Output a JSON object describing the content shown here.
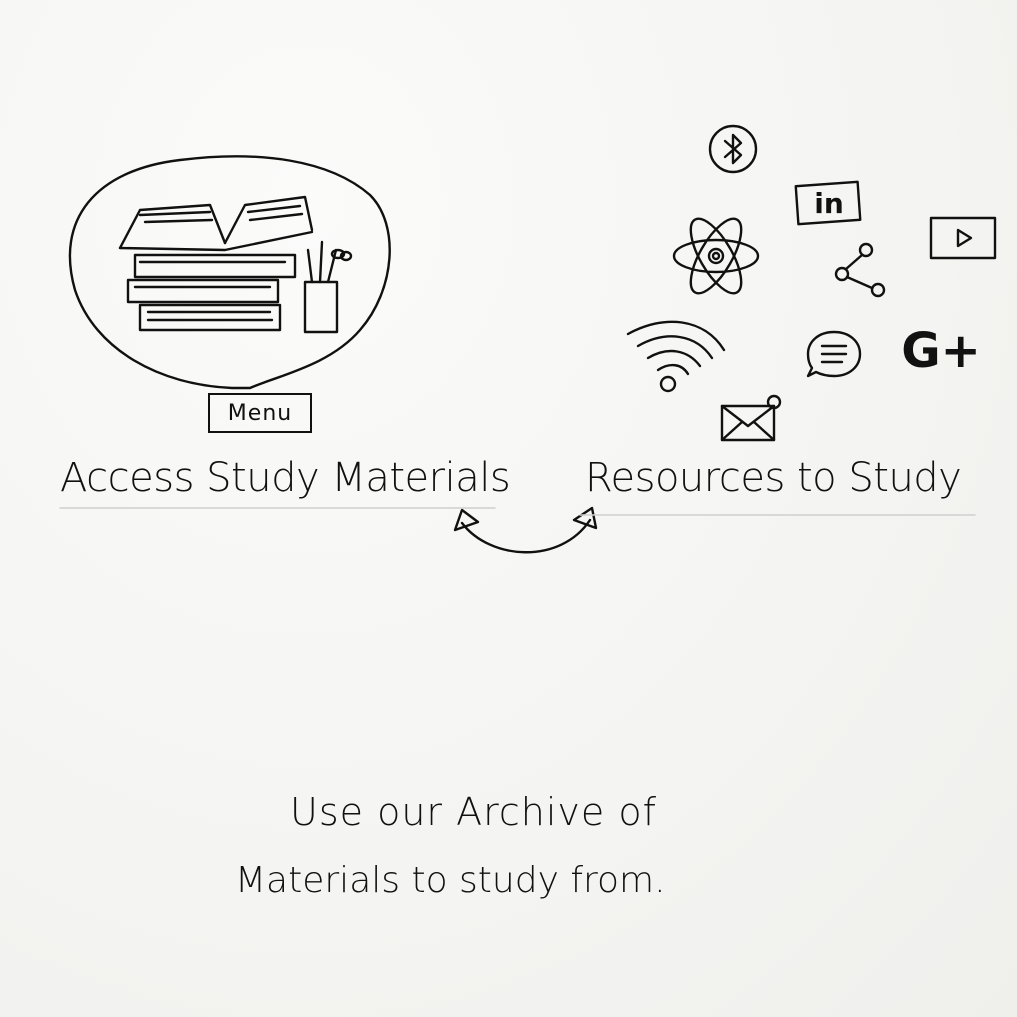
{
  "menu": {
    "label": "Menu"
  },
  "links": {
    "access_label": "Access Study Materials",
    "resources_label": "Resources to Study"
  },
  "caption": {
    "line1": "Use our Archive of",
    "line2": "Materials to study from."
  },
  "icons": {
    "linkedin_text": "in",
    "gplus_text": "G+"
  }
}
